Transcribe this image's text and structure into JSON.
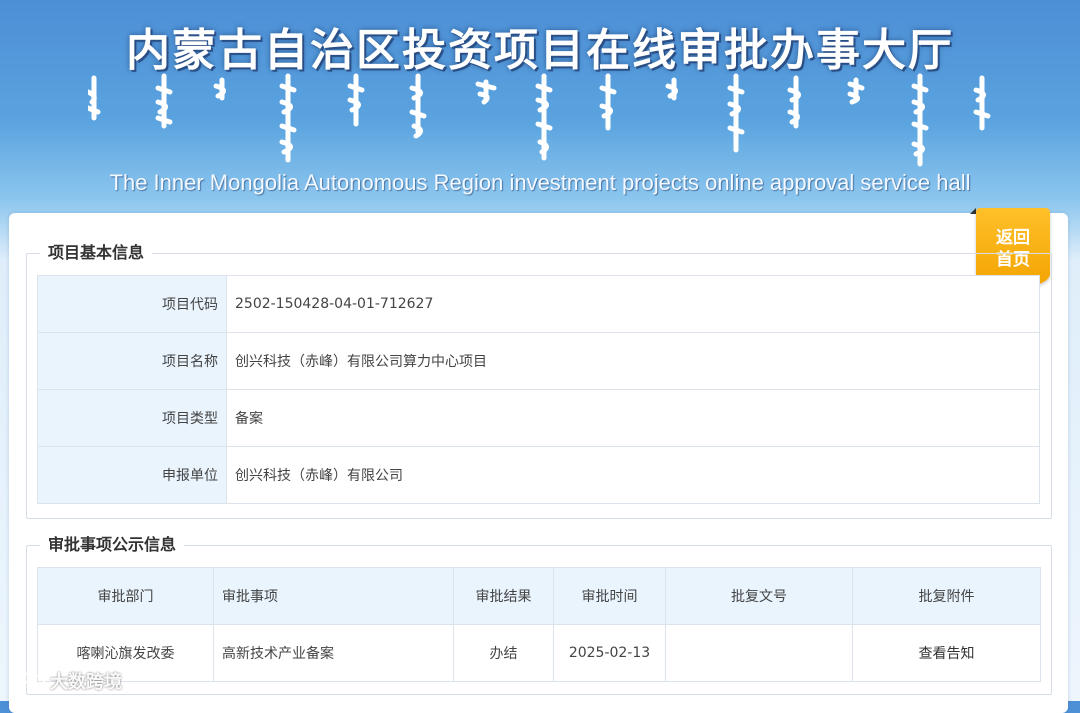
{
  "header": {
    "title_cn": "内蒙古自治区投资项目在线审批办事大厅",
    "title_en": "The Inner Mongolia Autonomous Region investment projects online approval service hall"
  },
  "back_button": {
    "line1": "返回",
    "line2": "首页"
  },
  "basic_info": {
    "legend": "项目基本信息",
    "rows": [
      {
        "label": "项目代码",
        "value": "2502-150428-04-01-712627"
      },
      {
        "label": "项目名称",
        "value": "创兴科技（赤峰）有限公司算力中心项目"
      },
      {
        "label": "项目类型",
        "value": "备案"
      },
      {
        "label": "申报单位",
        "value": "创兴科技（赤峰）有限公司"
      }
    ]
  },
  "approval_info": {
    "legend": "审批事项公示信息",
    "columns": [
      "审批部门",
      "审批事项",
      "审批结果",
      "审批时间",
      "批复文号",
      "批复附件"
    ],
    "rows": [
      {
        "dept": "喀喇沁旗发改委",
        "item": "高新技术产业备案",
        "result": "办结",
        "time": "2025-02-13",
        "doc_no": "",
        "attachment": "查看告知"
      }
    ]
  },
  "watermark": {
    "text": "大数跨境"
  },
  "colors": {
    "accent": "#f2a400",
    "header_blue": "#4d8fd6",
    "label_bg": "#e9f4fd"
  }
}
